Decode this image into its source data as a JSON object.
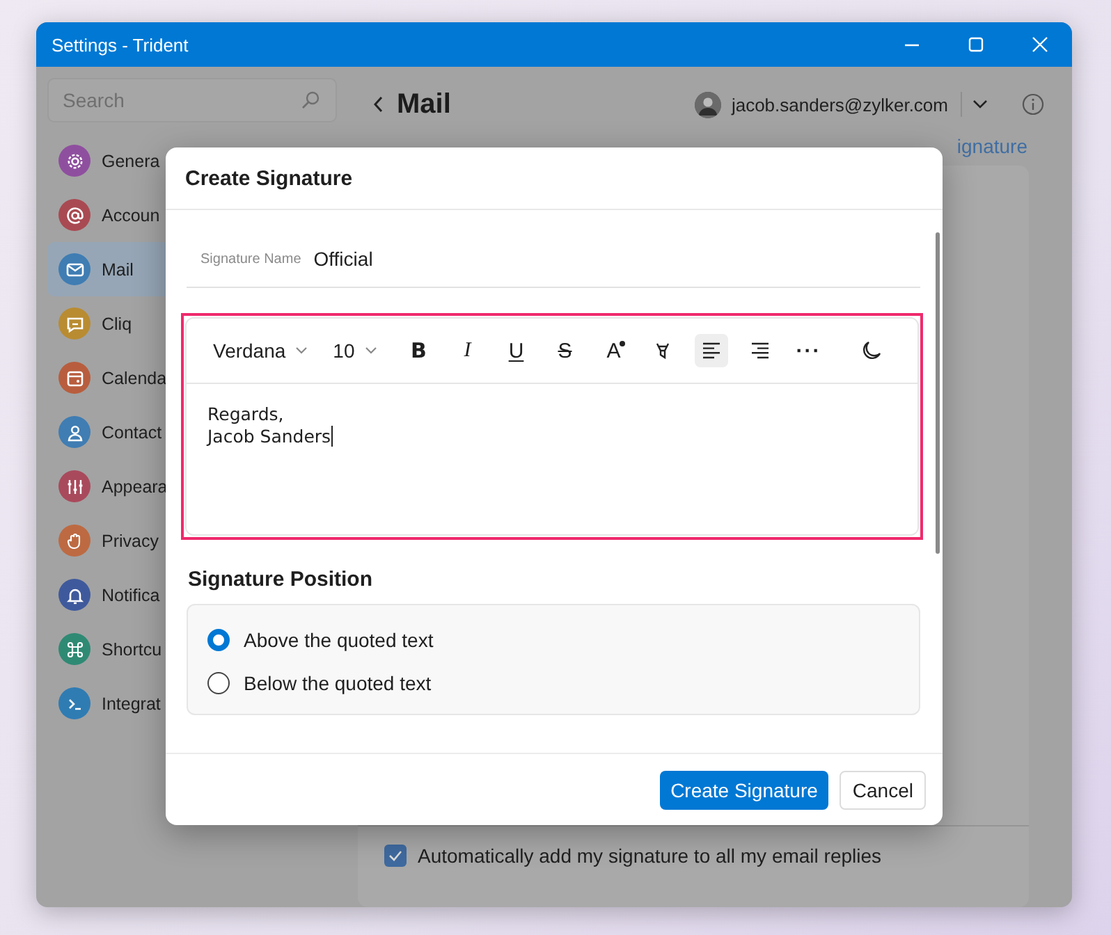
{
  "window": {
    "title": "Settings - Trident"
  },
  "sidebar": {
    "search": {
      "placeholder": "Search"
    },
    "items": [
      {
        "label": "Genera",
        "color": "#8f4f9f",
        "selected": false
      },
      {
        "label": "Accoun",
        "color": "#a94a52",
        "selected": false
      },
      {
        "label": "Mail",
        "color": "#3f7db3",
        "selected": true
      },
      {
        "label": "Cliq",
        "color": "#b98c32",
        "selected": false
      },
      {
        "label": "Calenda",
        "color": "#b85e3e",
        "selected": false
      },
      {
        "label": "Contact",
        "color": "#3f7db3",
        "selected": false
      },
      {
        "label": "Appeara",
        "color": "#a94a5c",
        "selected": false
      },
      {
        "label": "Privacy",
        "color": "#bd6a42",
        "selected": false
      },
      {
        "label": "Notifica",
        "color": "#3f5a9c",
        "selected": false
      },
      {
        "label": "Shortcu",
        "color": "#2f8a74",
        "selected": false
      },
      {
        "label": "Integrat",
        "color": "#2f7cb3",
        "selected": false
      }
    ]
  },
  "header": {
    "title": "Mail",
    "account": "jacob.sanders@zylker.com"
  },
  "content": {
    "link": "ignature",
    "auto_add": {
      "label": "Automatically add my signature to all my email replies",
      "checked": true
    }
  },
  "dialog": {
    "title": "Create Signature",
    "name": {
      "label": "Signature Name",
      "value": "Official"
    },
    "toolbar": {
      "font": "Verdana",
      "size": "10",
      "tools": [
        {
          "kind": "bold",
          "label": "B",
          "selected": false
        },
        {
          "kind": "italic",
          "label": "I",
          "selected": false
        },
        {
          "kind": "underline",
          "label": "U",
          "selected": false
        },
        {
          "kind": "strike",
          "label": "S",
          "selected": false
        },
        {
          "kind": "font-color",
          "label": "A",
          "selected": false
        },
        {
          "kind": "highlight",
          "selected": false
        },
        {
          "kind": "align-left",
          "selected": true
        },
        {
          "kind": "align-right",
          "selected": false
        },
        {
          "kind": "more",
          "label": "···",
          "selected": false
        },
        {
          "kind": "dark-mode",
          "selected": false
        }
      ]
    },
    "body": [
      "Regards,",
      "Jacob Sanders"
    ],
    "position": {
      "title": "Signature Position",
      "options": [
        {
          "label": "Above the quoted text",
          "selected": true
        },
        {
          "label": "Below the quoted text",
          "selected": false
        }
      ]
    },
    "buttons": [
      {
        "label": "Create Signature",
        "kind": "primary"
      },
      {
        "label": "Cancel",
        "kind": "secondary"
      }
    ]
  }
}
